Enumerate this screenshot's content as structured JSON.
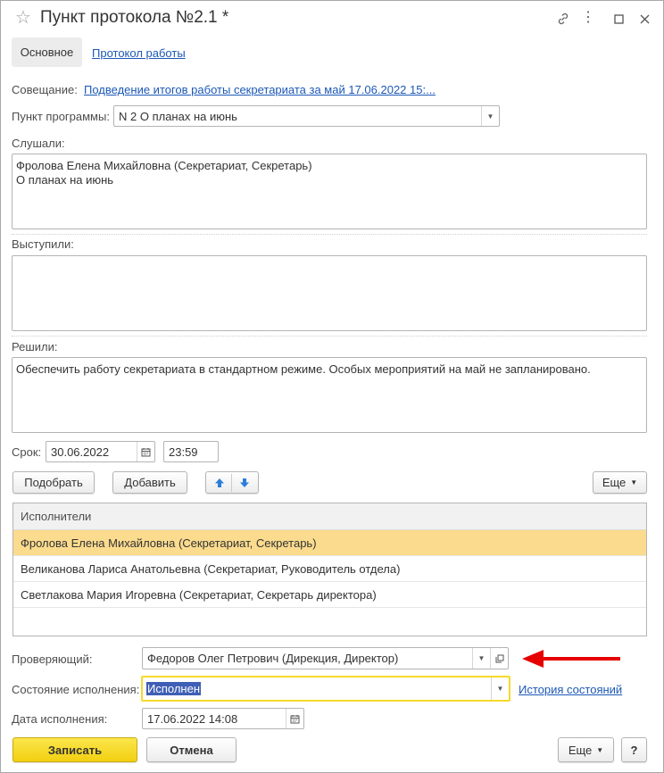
{
  "window": {
    "title": "Пункт протокола №2.1 *"
  },
  "tabs": [
    {
      "label": "Основное"
    },
    {
      "label": "Протокол работы"
    }
  ],
  "meeting": {
    "label": "Совещание:",
    "value": "Подведение итогов работы секретариата за май 17.06.2022 15:..."
  },
  "program_item": {
    "label": "Пункт программы:",
    "value": "N 2 О планах на июнь"
  },
  "listened": {
    "label": "Слушали:",
    "text": "Фролова Елена Михайловна (Секретариат, Секретарь)\nО планах на июнь"
  },
  "spoke": {
    "label": "Выступили:",
    "text": ""
  },
  "decided": {
    "label": "Решили:",
    "text": "Обеспечить работу секретариата в стандартном режиме. Особых мероприятий на май не запланировано."
  },
  "deadline": {
    "label": "Срок:",
    "date": "30.06.2022",
    "time": "23:59"
  },
  "toolbar": {
    "pick": "Подобрать",
    "add": "Добавить",
    "more": "Еще"
  },
  "executors": {
    "header": "Исполнители",
    "rows": [
      "Фролова Елена Михайловна (Секретариат, Секретарь)",
      "Великанова Лариса Анатольевна (Секретариат, Руководитель отдела)",
      "Светлакова Мария Игоревна (Секретариат, Секретарь директора)"
    ]
  },
  "checker": {
    "label": "Проверяющий:",
    "value": "Федоров Олег Петрович (Дирекция, Директор)"
  },
  "status": {
    "label": "Состояние исполнения:",
    "value": "Исполнен",
    "history_link": "История состояний"
  },
  "exec_date": {
    "label": "Дата исполнения:",
    "value": "17.06.2022 14:08"
  },
  "footer": {
    "save": "Записать",
    "cancel": "Отмена",
    "more": "Еще",
    "help": "?"
  },
  "colors": {
    "accent_yellow": "#f6d92c",
    "selected_row": "#fbdb8d",
    "link": "#1c58b6",
    "arrow": "#e60000"
  }
}
